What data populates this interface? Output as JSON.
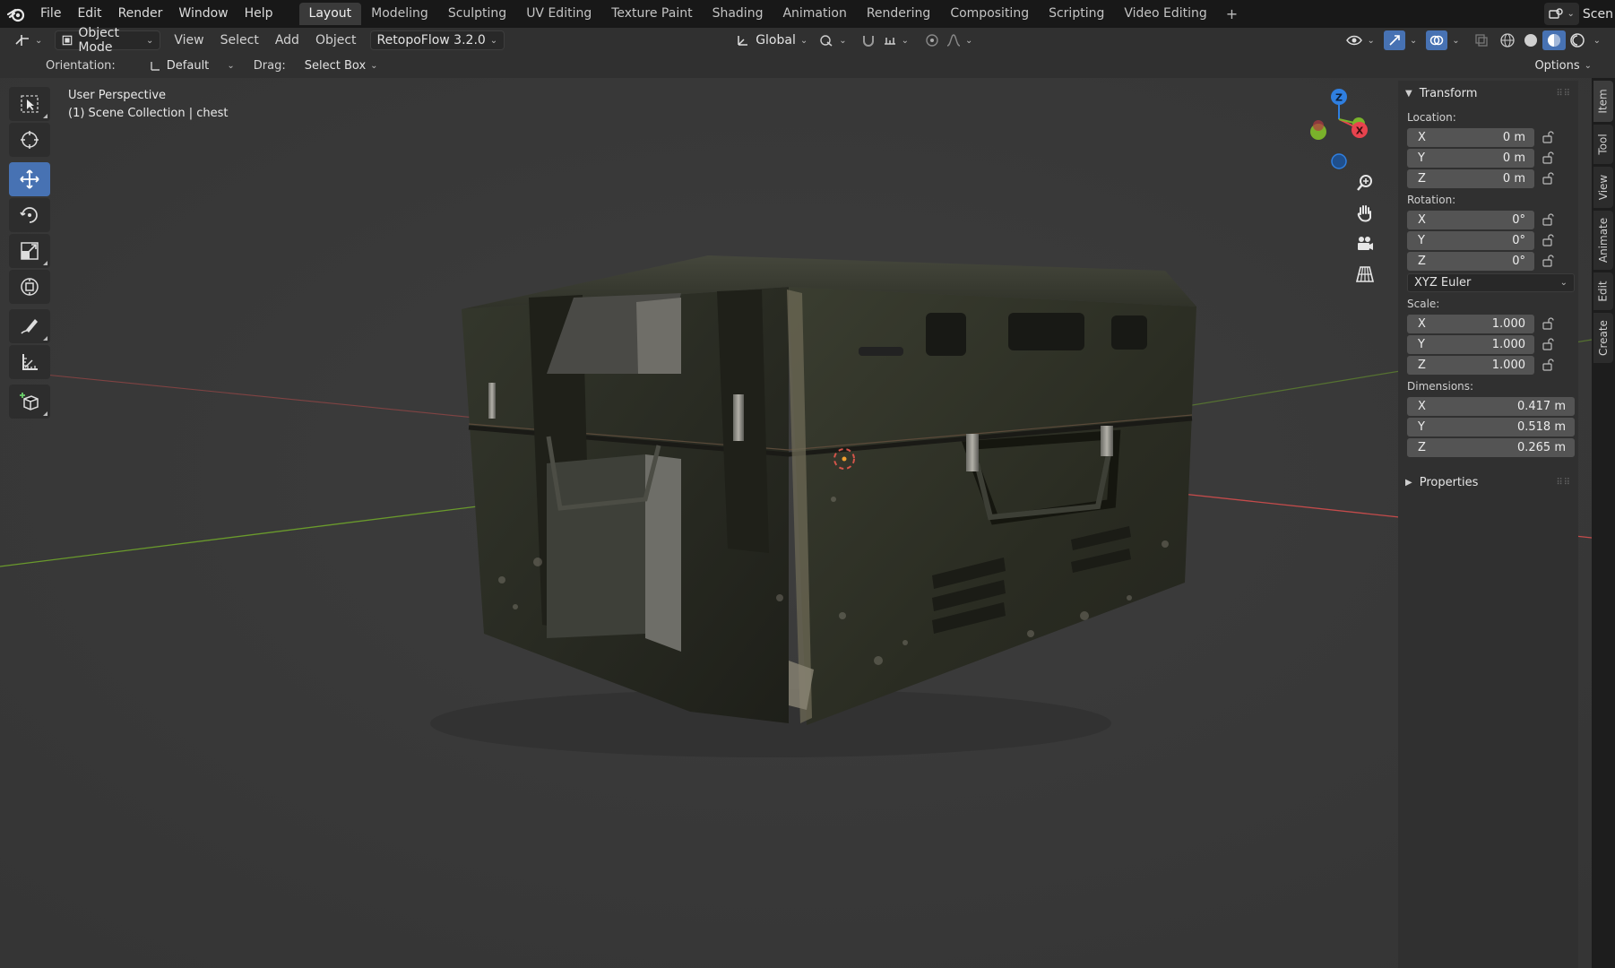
{
  "menu": [
    "File",
    "Edit",
    "Render",
    "Window",
    "Help"
  ],
  "workspaces": [
    "Layout",
    "Modeling",
    "Sculpting",
    "UV Editing",
    "Texture Paint",
    "Shading",
    "Animation",
    "Rendering",
    "Compositing",
    "Scripting",
    "Video Editing"
  ],
  "active_workspace": "Layout",
  "scene_label": "Scen",
  "header": {
    "mode": "Object Mode",
    "view": "View",
    "select": "Select",
    "add": "Add",
    "object": "Object",
    "addon": "RetopoFlow 3.2.0",
    "transform_space": "Global",
    "orientation_label": "Orientation:",
    "orientation_value": "Default",
    "drag_label": "Drag:",
    "drag_value": "Select Box",
    "options": "Options"
  },
  "viewport": {
    "perspective": "User Perspective",
    "collection": "(1) Scene Collection | chest"
  },
  "gizmo": {
    "x": "X",
    "y": "Y",
    "z": "Z"
  },
  "transform": {
    "title": "Transform",
    "location_label": "Location:",
    "location": [
      {
        "axis": "X",
        "value": "0 m"
      },
      {
        "axis": "Y",
        "value": "0 m"
      },
      {
        "axis": "Z",
        "value": "0 m"
      }
    ],
    "rotation_label": "Rotation:",
    "rotation": [
      {
        "axis": "X",
        "value": "0°"
      },
      {
        "axis": "Y",
        "value": "0°"
      },
      {
        "axis": "Z",
        "value": "0°"
      }
    ],
    "rotation_mode": "XYZ Euler",
    "scale_label": "Scale:",
    "scale": [
      {
        "axis": "X",
        "value": "1.000"
      },
      {
        "axis": "Y",
        "value": "1.000"
      },
      {
        "axis": "Z",
        "value": "1.000"
      }
    ],
    "dimensions_label": "Dimensions:",
    "dimensions": [
      {
        "axis": "X",
        "value": "0.417 m"
      },
      {
        "axis": "Y",
        "value": "0.518 m"
      },
      {
        "axis": "Z",
        "value": "0.265 m"
      }
    ]
  },
  "properties": {
    "title": "Properties"
  },
  "side_tabs": [
    "Item",
    "Tool",
    "View",
    "Animate",
    "Edit",
    "Create"
  ],
  "colors": {
    "accent": "#4772b3",
    "axis_x": "#e8434e",
    "axis_y": "#7ab22b",
    "axis_z": "#2f7fe0",
    "viewport_bg": "#393939"
  }
}
